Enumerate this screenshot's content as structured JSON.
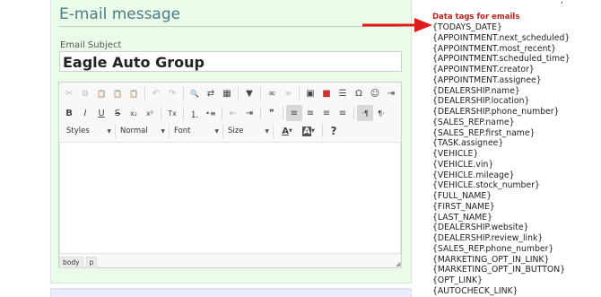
{
  "email": {
    "section_title": "E-mail message",
    "subject_label": "Email Subject",
    "subject_value": "Eagle Auto Group"
  },
  "toolbar": {
    "row1": [
      {
        "name": "cut-icon",
        "glyph": "✂",
        "disabled": true
      },
      {
        "name": "copy-icon",
        "glyph": "⧉",
        "disabled": true
      },
      {
        "name": "paste-icon",
        "glyph": "📋",
        "disabled": false
      },
      {
        "name": "paste-text-icon",
        "glyph": "📋",
        "disabled": false
      },
      {
        "name": "paste-word-icon",
        "glyph": "📋",
        "disabled": false
      },
      {
        "sep": true
      },
      {
        "name": "undo-icon",
        "glyph": "↶",
        "disabled": true
      },
      {
        "name": "redo-icon",
        "glyph": "↷",
        "disabled": true
      },
      {
        "sep": true
      },
      {
        "name": "find-icon",
        "glyph": "🔍",
        "disabled": false
      },
      {
        "name": "replace-icon",
        "glyph": "⇄",
        "disabled": false
      },
      {
        "name": "select-all-icon",
        "glyph": "▦",
        "disabled": false
      },
      {
        "sep": true
      },
      {
        "name": "spellcheck-icon",
        "glyph": "▼",
        "disabled": false
      },
      {
        "sep": true
      },
      {
        "name": "link-icon",
        "glyph": "∞",
        "disabled": false
      },
      {
        "name": "unlink-icon",
        "glyph": "∞",
        "disabled": true
      },
      {
        "sep": true
      },
      {
        "name": "image-icon",
        "glyph": "▣",
        "disabled": false
      },
      {
        "name": "video-icon",
        "glyph": "■",
        "disabled": false
      },
      {
        "name": "horizontal-line-icon",
        "glyph": "☰",
        "disabled": false
      },
      {
        "name": "special-char-icon",
        "glyph": "Ω",
        "disabled": false
      },
      {
        "name": "emoji-icon",
        "glyph": "☺",
        "disabled": false
      },
      {
        "name": "page-break-icon",
        "glyph": "⇥",
        "disabled": false
      }
    ],
    "row2": [
      {
        "name": "bold-icon",
        "glyph": "B",
        "disabled": false
      },
      {
        "name": "italic-icon",
        "glyph": "I",
        "disabled": false
      },
      {
        "name": "underline-icon",
        "glyph": "U",
        "disabled": false
      },
      {
        "name": "strikethrough-icon",
        "glyph": "S",
        "disabled": false
      },
      {
        "name": "subscript-icon",
        "glyph": "x₂",
        "disabled": false
      },
      {
        "name": "superscript-icon",
        "glyph": "x²",
        "disabled": false
      },
      {
        "sep": true
      },
      {
        "name": "remove-format-icon",
        "glyph": "Tx",
        "disabled": false
      },
      {
        "sep": true
      },
      {
        "name": "numbered-list-icon",
        "glyph": "⒈",
        "disabled": false
      },
      {
        "name": "bulleted-list-icon",
        "glyph": "•≡",
        "disabled": false
      },
      {
        "sep": true
      },
      {
        "name": "outdent-icon",
        "glyph": "⇤",
        "disabled": true
      },
      {
        "name": "indent-icon",
        "glyph": "⇥",
        "disabled": false
      },
      {
        "sep": true
      },
      {
        "name": "blockquote-icon",
        "glyph": "❞",
        "disabled": false
      },
      {
        "sep": true
      },
      {
        "name": "align-left-icon",
        "glyph": "≡",
        "disabled": false,
        "active": true
      },
      {
        "name": "align-center-icon",
        "glyph": "≡",
        "disabled": false
      },
      {
        "name": "align-right-icon",
        "glyph": "≡",
        "disabled": false
      },
      {
        "name": "align-justify-icon",
        "glyph": "≡",
        "disabled": false
      },
      {
        "sep": true
      },
      {
        "name": "ltr-icon",
        "glyph": "·¶",
        "disabled": false,
        "active": true
      },
      {
        "name": "rtl-icon",
        "glyph": "¶·",
        "disabled": false
      }
    ],
    "styles_label": "Styles",
    "format_label": "Normal",
    "font_label": "Font",
    "size_label": "Size",
    "text_color_icon": "text-color-icon",
    "bg_color_icon": "background-color-icon",
    "help_icon": "help-icon"
  },
  "path": [
    "body",
    "p"
  ],
  "tags": {
    "title": "Data tags for emails",
    "items": [
      "{TODAYS_DATE}",
      "{APPOINTMENT.next_scheduled}",
      "{APPOINTMENT.most_recent}",
      "{APPOINTMENT.scheduled_time}",
      "{APPOINTMENT.creator}",
      "{APPOINTMENT.assignee}",
      "{DEALERSHIP.name}",
      "{DEALERSHIP.location}",
      "{DEALERSHIP.phone_number}",
      "{SALES_REP.name}",
      "{SALES_REP.first_name}",
      "{TASK.assignee}",
      "{VEHICLE}",
      "{VEHICLE.vin}",
      "{VEHICLE.mileage}",
      "{VEHICLE.stock_number}",
      "{FULL_NAME}",
      "{FIRST_NAME}",
      "{LAST_NAME}",
      "{DEALERSHIP.website}",
      "{DEALERSHIP.review_link}",
      "{SALES_REP.phone_number}",
      "{MARKETING_OPT_IN_LINK}",
      "{MARKETING_OPT_IN_BUTTON}",
      "{OPT_LINK}",
      "{AUTOCHECK_LINK}"
    ]
  },
  "colors": {
    "panel_bg": "#ebfbe9",
    "title_color": "#4a7d86",
    "tags_title_color": "#c0201a",
    "arrow_color": "#e01b1b"
  }
}
